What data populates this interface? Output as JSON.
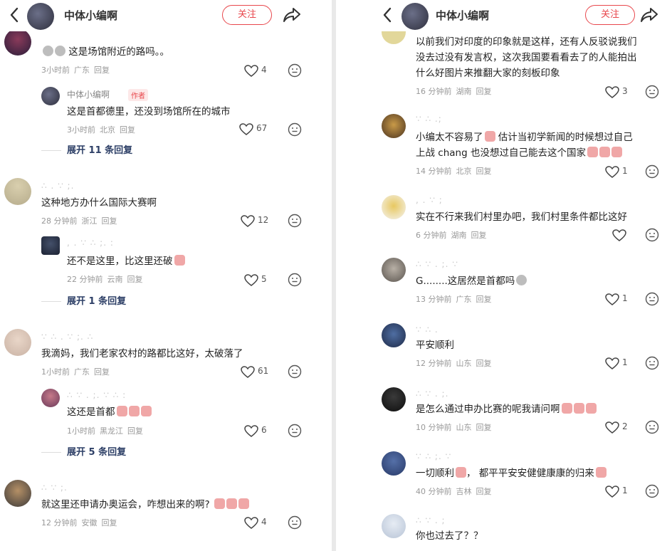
{
  "header": {
    "title": "中体小编啊",
    "follow_label": "关注"
  },
  "left": {
    "c1": {
      "text": "这是场馆附近的路吗。。",
      "time": "3小时前",
      "region": "广东",
      "reply": "回复",
      "likes": "4"
    },
    "c1r": {
      "name": "中体小编啊",
      "badge": "作者",
      "text": "这是首都德里，还没到场馆所在的城市",
      "time": "3小时前",
      "region": "北京",
      "reply": "回复",
      "likes": "67"
    },
    "c1x": "展开 11 条回复",
    "c2": {
      "text": "这种地方办什么国际大赛啊",
      "time": "28 分钟前",
      "region": "浙江",
      "reply": "回复",
      "likes": "12"
    },
    "c2r": {
      "text": "还不是这里，比这里还破",
      "time": "22 分钟前",
      "region": "云南",
      "reply": "回复",
      "likes": "5"
    },
    "c2x": "展开 1 条回复",
    "c3": {
      "text": "我滴妈，我们老家农村的路都比这好，太破落了",
      "time": "1小时前",
      "region": "广东",
      "reply": "回复",
      "likes": "61"
    },
    "c3r": {
      "text": "这还是首都",
      "time": "1小时前",
      "region": "黑龙江",
      "reply": "回复",
      "likes": "6"
    },
    "c3x": "展开 5 条回复",
    "c4": {
      "text": "就这里还申请办奥运会，咋想出来的啊?",
      "time": "12 分钟前",
      "region": "安徽",
      "reply": "回复",
      "likes": "4"
    }
  },
  "right": {
    "r1": {
      "text1": "以前我们对印度的印象就是这样，还有人反驳说我们",
      "text2": "没去过没有发言权，这次我国要看看去了的人能拍出",
      "text3": "什么好图片来推翻大家的刻板印象",
      "time": "16 分钟前",
      "region": "湖南",
      "reply": "回复",
      "likes": "3"
    },
    "r2": {
      "text1": "小编太不容易了",
      "text1b": "估计当初学新闻的时候想过自己",
      "text2": "上战 chang 也没想过自己能去这个国家",
      "time": "14 分钟前",
      "region": "北京",
      "reply": "回复",
      "likes": "1"
    },
    "r3": {
      "text": "实在不行来我们村里办吧，我们村里条件都比这好",
      "time": "6 分钟前",
      "region": "湖南",
      "reply": "回复",
      "likes": ""
    },
    "r4": {
      "text": "G........这居然是首都吗",
      "time": "13 分钟前",
      "region": "广东",
      "reply": "回复",
      "likes": "1"
    },
    "r5": {
      "text": "平安顺利",
      "time": "12 分钟前",
      "region": "山东",
      "reply": "回复",
      "likes": "1"
    },
    "r6": {
      "text": "是怎么通过申办比赛的呢我请问啊",
      "time": "10 分钟前",
      "region": "山东",
      "reply": "回复",
      "likes": "2"
    },
    "r7": {
      "text": "一切顺利",
      "text_b": "都平平安安健健康康的归来",
      "time": "40 分钟前",
      "region": "吉林",
      "reply": "回复",
      "likes": "1"
    },
    "r8": {
      "text": "你也过去了？？"
    }
  },
  "colors": {
    "accent": "#e8474c",
    "expand": "#2d3f66"
  }
}
